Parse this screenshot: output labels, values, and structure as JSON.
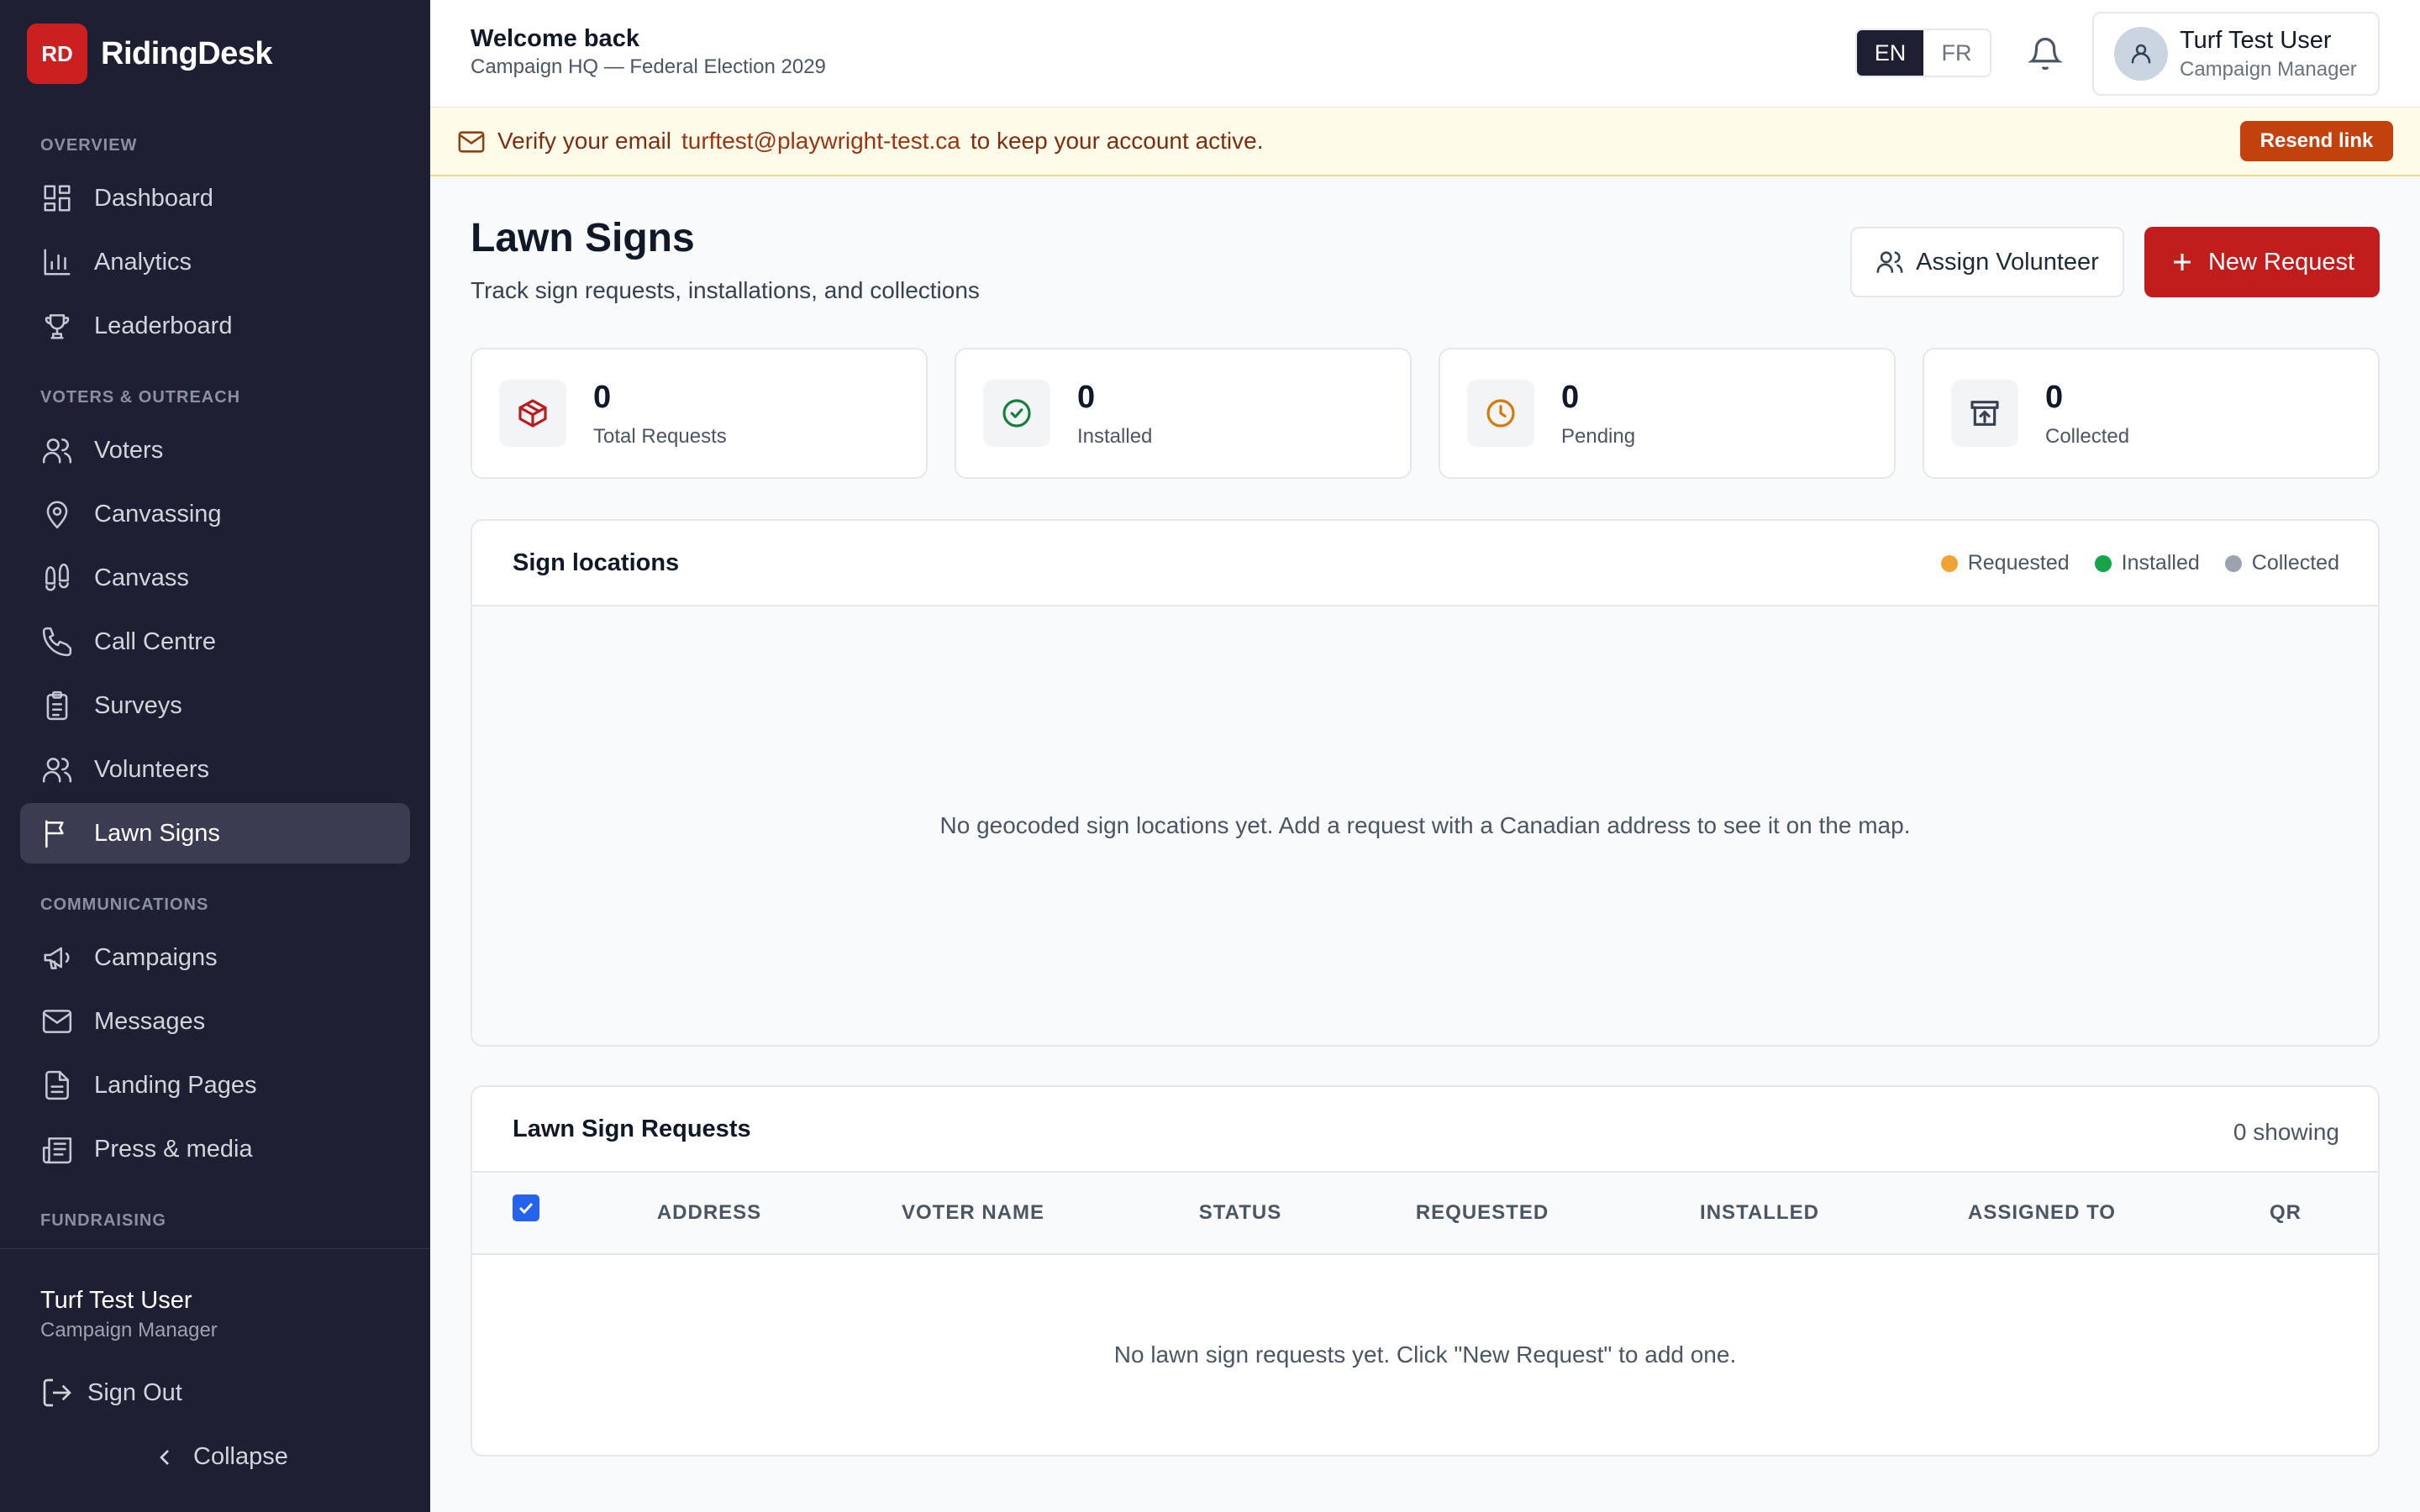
{
  "brand": {
    "logo": "RD",
    "name": "RidingDesk"
  },
  "sidebar": {
    "sections": {
      "overview": "OVERVIEW",
      "voters": "VOTERS & OUTREACH",
      "communications": "COMMUNICATIONS",
      "fundraising": "FUNDRAISING"
    },
    "items": [
      {
        "label": "Dashboard",
        "icon": "dashboard-icon"
      },
      {
        "label": "Analytics",
        "icon": "bar-chart-icon"
      },
      {
        "label": "Leaderboard",
        "icon": "trophy-icon"
      },
      {
        "label": "Voters",
        "icon": "users-icon"
      },
      {
        "label": "Canvassing",
        "icon": "map-pin-icon"
      },
      {
        "label": "Canvass",
        "icon": "footprints-icon"
      },
      {
        "label": "Call Centre",
        "icon": "phone-icon"
      },
      {
        "label": "Surveys",
        "icon": "clipboard-icon"
      },
      {
        "label": "Volunteers",
        "icon": "users-icon"
      },
      {
        "label": "Lawn Signs",
        "icon": "flag-icon",
        "active": true
      },
      {
        "label": "Campaigns",
        "icon": "megaphone-icon"
      },
      {
        "label": "Messages",
        "icon": "mail-icon"
      },
      {
        "label": "Landing Pages",
        "icon": "file-icon"
      },
      {
        "label": "Press & media",
        "icon": "newspaper-icon"
      }
    ],
    "user_name": "Turf Test User",
    "user_role": "Campaign Manager",
    "sign_out": "Sign Out",
    "collapse": "Collapse"
  },
  "header": {
    "welcome": "Welcome back",
    "campaign": "Campaign HQ — Federal Election 2029",
    "lang_en": "EN",
    "lang_fr": "FR",
    "user_name": "Turf Test User",
    "user_role": "Campaign Manager"
  },
  "banner": {
    "before": "Verify your email",
    "email": "turftest@playwright-test.ca",
    "after": "to keep your account active.",
    "button": "Resend link"
  },
  "page": {
    "title": "Lawn Signs",
    "subtitle": "Track sign requests, installations, and collections",
    "assign_button": "Assign Volunteer",
    "new_button": "New Request"
  },
  "stats": [
    {
      "value": "0",
      "label": "Total Requests",
      "icon": "package-icon",
      "color": "#b91c1c"
    },
    {
      "value": "0",
      "label": "Installed",
      "icon": "check-circle-icon",
      "color": "#15803d"
    },
    {
      "value": "0",
      "label": "Pending",
      "icon": "clock-icon",
      "color": "#d97706"
    },
    {
      "value": "0",
      "label": "Collected",
      "icon": "archive-icon",
      "color": "#374151"
    }
  ],
  "map": {
    "title": "Sign locations",
    "legend": [
      {
        "label": "Requested",
        "color": "#f0a233"
      },
      {
        "label": "Installed",
        "color": "#16a34a"
      },
      {
        "label": "Collected",
        "color": "#9ca3af"
      }
    ],
    "empty": "No geocoded sign locations yet. Add a request with a Canadian address to see it on the map."
  },
  "table": {
    "title": "Lawn Sign Requests",
    "showing": "0 showing",
    "columns": [
      "ADDRESS",
      "VOTER NAME",
      "STATUS",
      "REQUESTED",
      "INSTALLED",
      "ASSIGNED TO",
      "QR"
    ],
    "select_all_checked": true,
    "empty": "No lawn sign requests yet. Click \"New Request\" to add one."
  }
}
